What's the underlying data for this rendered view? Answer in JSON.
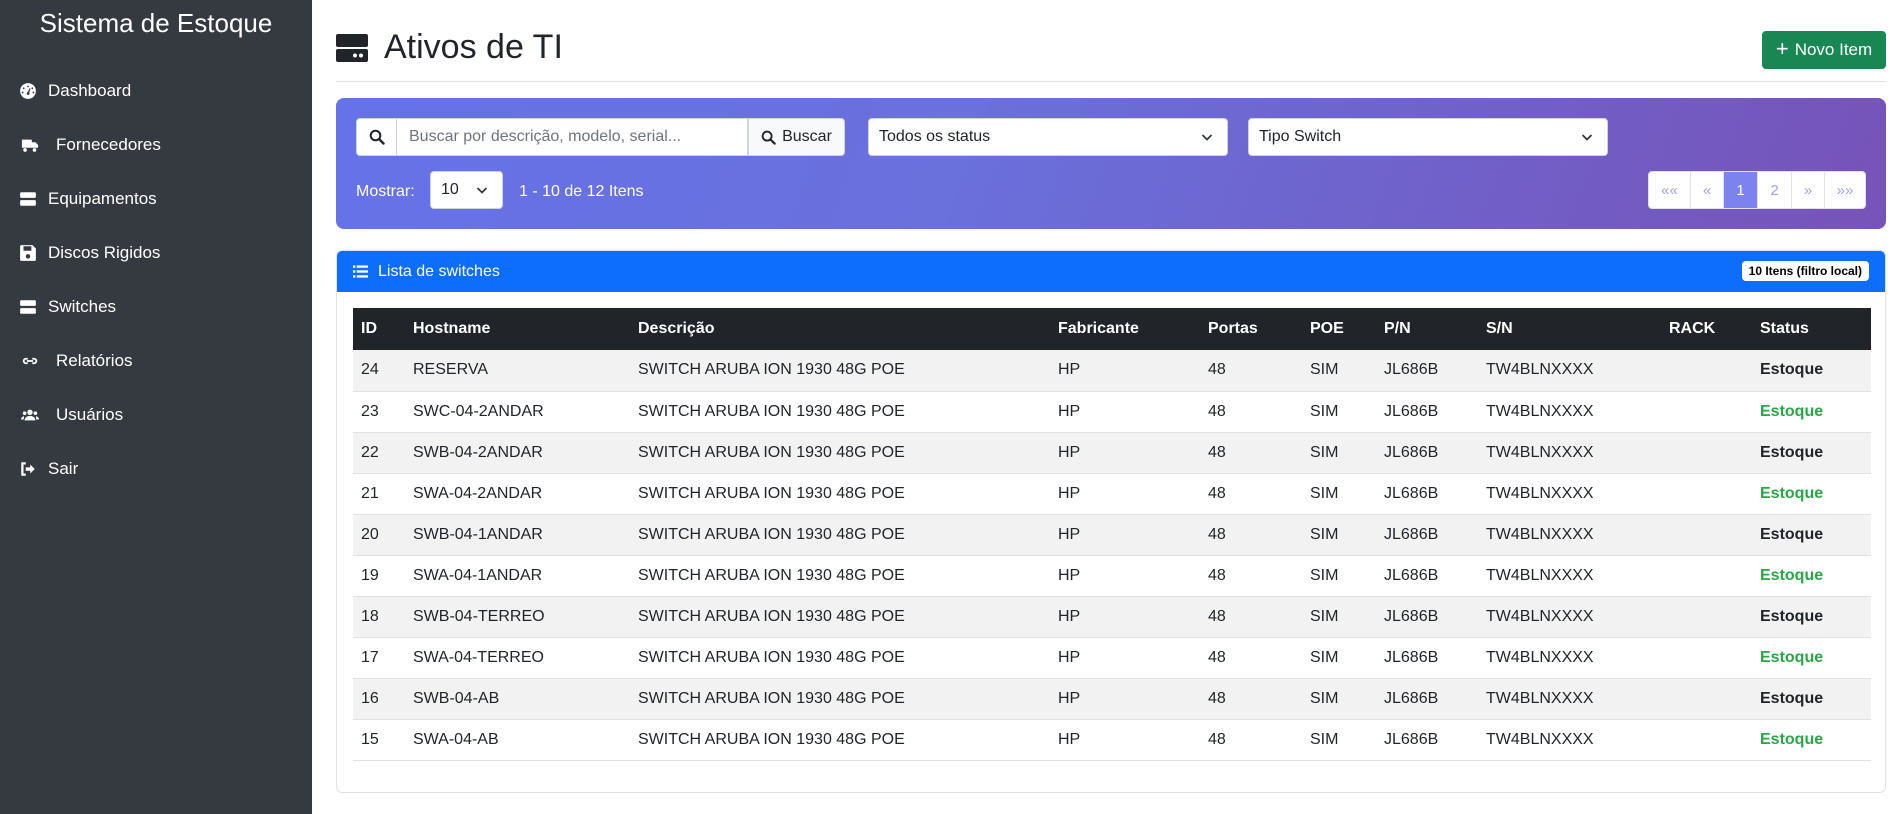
{
  "sidebar": {
    "brand": "Sistema de Estoque",
    "items": [
      {
        "label": "Dashboard",
        "icon": "dashboard-icon"
      },
      {
        "label": "Fornecedores",
        "icon": "truck-icon"
      },
      {
        "label": "Equipamentos",
        "icon": "server-icon"
      },
      {
        "label": "Discos Rigidos",
        "icon": "floppy-icon"
      },
      {
        "label": "Switches",
        "icon": "server-icon"
      },
      {
        "label": "Relatórios",
        "icon": "link-icon"
      },
      {
        "label": "Usuários",
        "icon": "users-icon"
      },
      {
        "label": "Sair",
        "icon": "sign-out-icon"
      }
    ]
  },
  "header": {
    "title": "Ativos de TI",
    "new_button": "Novo Item"
  },
  "filters": {
    "search_placeholder": "Buscar por descrição, modelo, serial...",
    "search_button": "Buscar",
    "status_select": "Todos os status",
    "type_select": "Tipo Switch",
    "show_label": "Mostrar:",
    "show_value": "10",
    "range_text": "1 - 10 de 12 Itens",
    "pagination": [
      "««",
      "«",
      "1",
      "2",
      "»",
      "»»"
    ],
    "active_page": "1"
  },
  "list": {
    "title": "Lista de switches",
    "badge": "10 Itens (filtro local)",
    "columns": [
      "ID",
      "Hostname",
      "Descrição",
      "Fabricante",
      "Portas",
      "POE",
      "P/N",
      "S/N",
      "RACK",
      "Status"
    ],
    "rows": [
      {
        "id": "24",
        "hostname": "RESERVA",
        "descricao": "SWITCH ARUBA ION 1930 48G POE",
        "fabricante": "HP",
        "portas": "48",
        "poe": "SIM",
        "pn": "JL686B",
        "sn": "TW4BLNXXXX",
        "rack": "",
        "status": "Estoque",
        "status_color": "#212529"
      },
      {
        "id": "23",
        "hostname": "SWC-04-2ANDAR",
        "descricao": "SWITCH ARUBA ION 1930 48G POE",
        "fabricante": "HP",
        "portas": "48",
        "poe": "SIM",
        "pn": "JL686B",
        "sn": "TW4BLNXXXX",
        "rack": "",
        "status": "Estoque",
        "status_color": "#28a745"
      },
      {
        "id": "22",
        "hostname": "SWB-04-2ANDAR",
        "descricao": "SWITCH ARUBA ION 1930 48G POE",
        "fabricante": "HP",
        "portas": "48",
        "poe": "SIM",
        "pn": "JL686B",
        "sn": "TW4BLNXXXX",
        "rack": "",
        "status": "Estoque",
        "status_color": "#212529"
      },
      {
        "id": "21",
        "hostname": "SWA-04-2ANDAR",
        "descricao": "SWITCH ARUBA ION 1930 48G POE",
        "fabricante": "HP",
        "portas": "48",
        "poe": "SIM",
        "pn": "JL686B",
        "sn": "TW4BLNXXXX",
        "rack": "",
        "status": "Estoque",
        "status_color": "#28a745"
      },
      {
        "id": "20",
        "hostname": "SWB-04-1ANDAR",
        "descricao": "SWITCH ARUBA ION 1930 48G POE",
        "fabricante": "HP",
        "portas": "48",
        "poe": "SIM",
        "pn": "JL686B",
        "sn": "TW4BLNXXXX",
        "rack": "",
        "status": "Estoque",
        "status_color": "#212529"
      },
      {
        "id": "19",
        "hostname": "SWA-04-1ANDAR",
        "descricao": "SWITCH ARUBA ION 1930 48G POE",
        "fabricante": "HP",
        "portas": "48",
        "poe": "SIM",
        "pn": "JL686B",
        "sn": "TW4BLNXXXX",
        "rack": "",
        "status": "Estoque",
        "status_color": "#28a745"
      },
      {
        "id": "18",
        "hostname": "SWB-04-TERREO",
        "descricao": "SWITCH ARUBA ION 1930 48G POE",
        "fabricante": "HP",
        "portas": "48",
        "poe": "SIM",
        "pn": "JL686B",
        "sn": "TW4BLNXXXX",
        "rack": "",
        "status": "Estoque",
        "status_color": "#212529"
      },
      {
        "id": "17",
        "hostname": "SWA-04-TERREO",
        "descricao": "SWITCH ARUBA ION 1930 48G POE",
        "fabricante": "HP",
        "portas": "48",
        "poe": "SIM",
        "pn": "JL686B",
        "sn": "TW4BLNXXXX",
        "rack": "",
        "status": "Estoque",
        "status_color": "#28a745"
      },
      {
        "id": "16",
        "hostname": "SWB-04-AB",
        "descricao": "SWITCH ARUBA ION 1930 48G POE",
        "fabricante": "HP",
        "portas": "48",
        "poe": "SIM",
        "pn": "JL686B",
        "sn": "TW4BLNXXXX",
        "rack": "",
        "status": "Estoque",
        "status_color": "#212529"
      },
      {
        "id": "15",
        "hostname": "SWA-04-AB",
        "descricao": "SWITCH ARUBA ION 1930 48G POE",
        "fabricante": "HP",
        "portas": "48",
        "poe": "SIM",
        "pn": "JL686B",
        "sn": "TW4BLNXXXX",
        "rack": "",
        "status": "Estoque",
        "status_color": "#28a745"
      }
    ]
  },
  "colors": {
    "sidebar_bg": "#343a40",
    "primary": "#0d6efd",
    "success": "#198754",
    "status_green": "#28a745"
  }
}
